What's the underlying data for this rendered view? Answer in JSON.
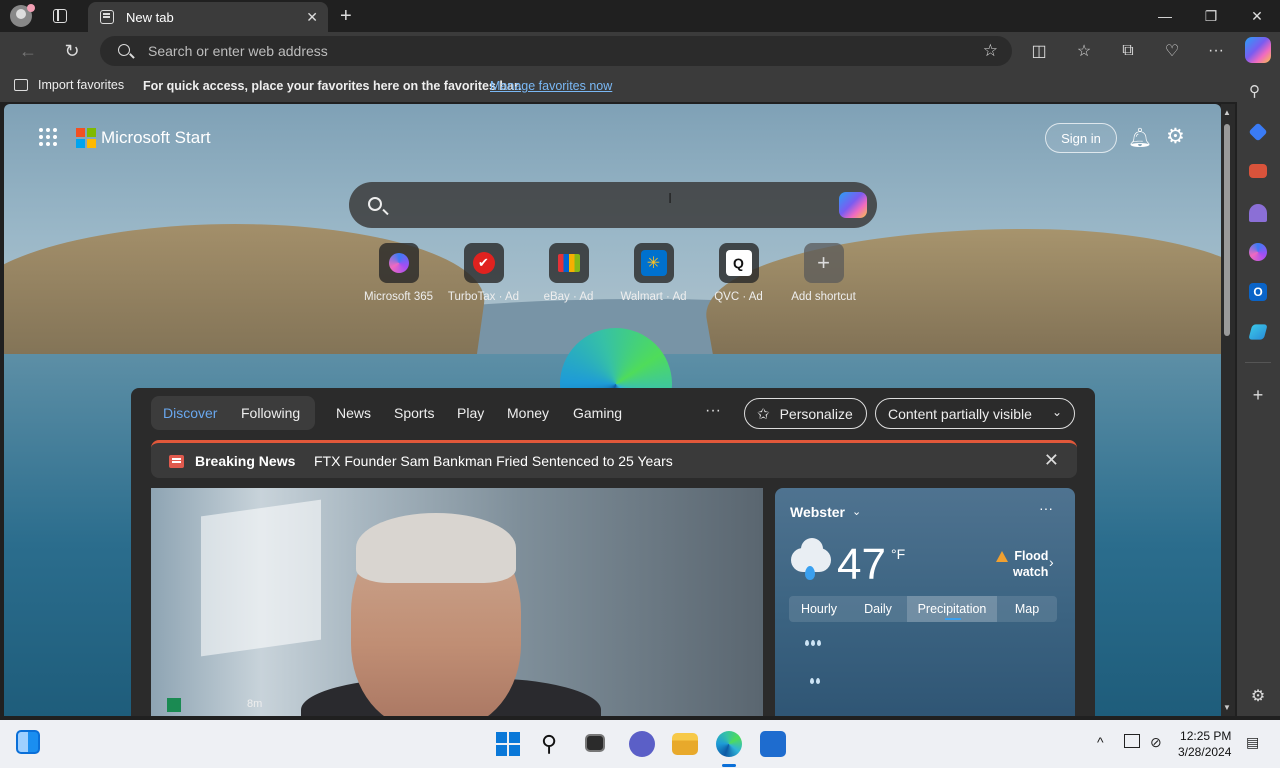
{
  "browser": {
    "tab_title": "New tab",
    "address_placeholder": "Search or enter web address",
    "favorites_bar": {
      "import_label": "Import favorites",
      "message": "For quick access, place your favorites here on the favorites bar.",
      "link": "Manage favorites now"
    }
  },
  "page": {
    "brand": "Microsoft Start",
    "sign_in": "Sign in",
    "shortcuts": [
      {
        "label": "Microsoft 365"
      },
      {
        "label": "TurboTax · Ad"
      },
      {
        "label": "eBay · Ad"
      },
      {
        "label": "Walmart · Ad"
      },
      {
        "label": "QVC · Ad"
      },
      {
        "label": "Add shortcut"
      }
    ]
  },
  "feed": {
    "tabs": [
      "Discover",
      "Following"
    ],
    "categories": [
      "News",
      "Sports",
      "Play",
      "Money",
      "Gaming"
    ],
    "more": "···",
    "personalize": "Personalize",
    "content_filter": "Content partially visible",
    "breaking": {
      "label": "Breaking News",
      "headline": "FTX Founder Sam Bankman Fried Sentenced to 25 Years"
    },
    "story_time": "8m"
  },
  "weather": {
    "city": "Webster",
    "temp": "47",
    "unit": "°F",
    "alert_line1": "Flood",
    "alert_line2": "watch",
    "tabs": [
      "Hourly",
      "Daily",
      "Precipitation",
      "Map"
    ],
    "active_tab": "Precipitation"
  },
  "taskbar": {
    "time": "12:25 PM",
    "date": "3/28/2024"
  },
  "colors": {
    "accent": "#69a7ee",
    "breaking": "#e1583a",
    "link": "#7ab8f5"
  }
}
